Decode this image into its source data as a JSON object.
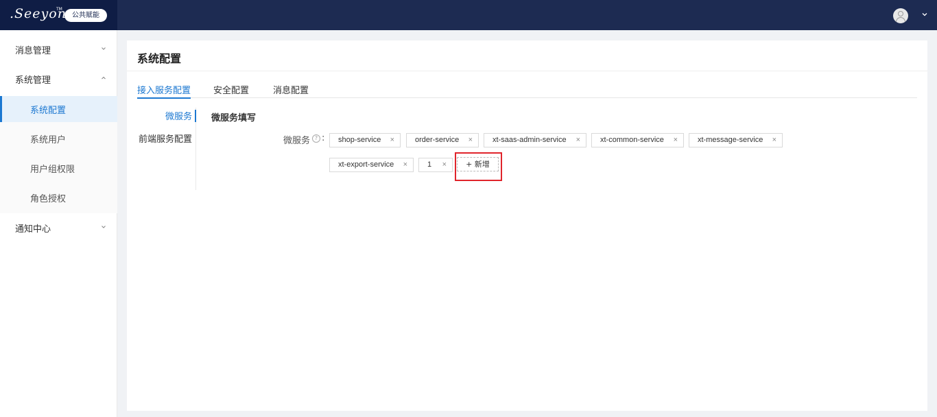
{
  "brand": {
    "logo_text": ".Seeyon",
    "tm": "TM",
    "badge": "公共赋能"
  },
  "header": {
    "user_avatar_icon": "user-icon",
    "user_menu_icon": "chevron-down-icon"
  },
  "sidebar": {
    "groups": [
      {
        "label": "消息管理",
        "expanded": false
      },
      {
        "label": "系统管理",
        "expanded": true
      },
      {
        "label": "通知中心",
        "expanded": false
      }
    ],
    "sub_items": [
      {
        "label": "系统配置",
        "active": true
      },
      {
        "label": "系统用户",
        "active": false
      },
      {
        "label": "用户组权限",
        "active": false
      },
      {
        "label": "角色授权",
        "active": false
      }
    ]
  },
  "page": {
    "title": "系统配置",
    "tabs": [
      {
        "label": "接入服务配置",
        "active": true
      },
      {
        "label": "安全配置",
        "active": false
      },
      {
        "label": "消息配置",
        "active": false
      }
    ],
    "side_nav": [
      {
        "label": "微服务",
        "active": true
      },
      {
        "label": "前端服务配置",
        "active": false
      }
    ],
    "section_title": "微服务填写",
    "field_label": "微服务",
    "help_icon": "?",
    "colon": ":",
    "tags": [
      "shop-service",
      "order-service",
      "xt-saas-admin-service",
      "xt-common-service",
      "xt-message-service",
      "xt-export-service",
      "1"
    ],
    "tag_close_glyph": "×",
    "add_button_label": "+ 新增"
  },
  "colors": {
    "topbar": "#1d2b52",
    "accent": "#1c78d1",
    "highlight": "#e0242b"
  }
}
